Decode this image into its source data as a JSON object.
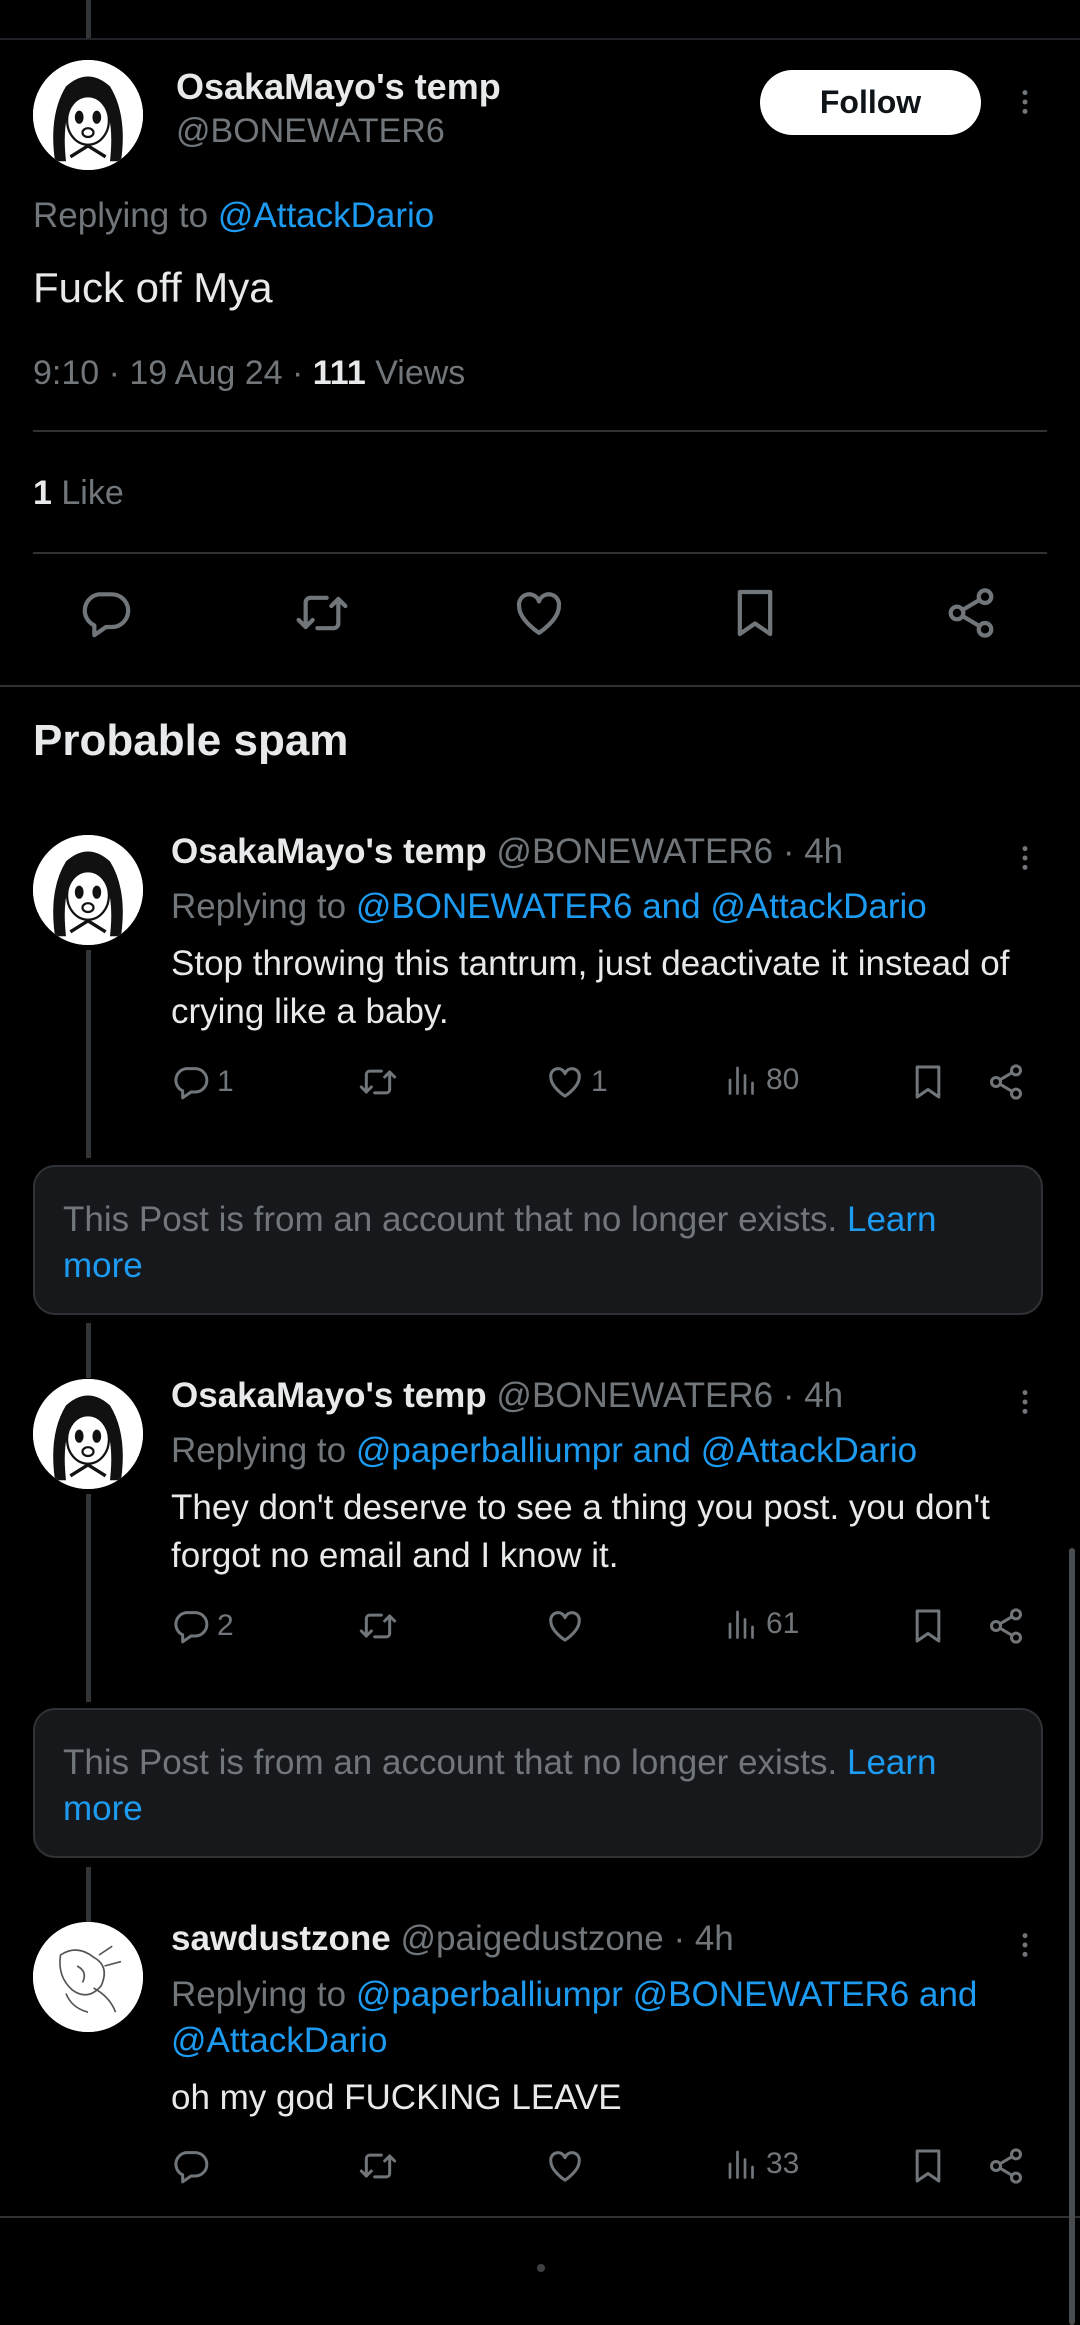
{
  "main_post": {
    "display_name": "OsakaMayo's temp",
    "handle": "@BONEWATER6",
    "follow_label": "Follow",
    "replying_prefix": "Replying to",
    "replying_to": "@AttackDario",
    "text": "Fuck off Mya",
    "time": "9:10 · 19 Aug 24 · ",
    "views_count": "111",
    "views_label": " Views",
    "likes_count": "1",
    "likes_label": " Like"
  },
  "section_title": "Probable spam",
  "replies": [
    {
      "display_name": "OsakaMayo's temp",
      "handle": "@BONEWATER6 · 4h",
      "replying_prefix": "Replying to ",
      "replying_to": "@BONEWATER6 and @AttackDario",
      "text": "Stop throwing this tantrum, just deactivate it instead of crying like a baby.",
      "comments": "1",
      "likes": "1",
      "views": "80"
    },
    {
      "display_name": "OsakaMayo's temp",
      "handle": "@BONEWATER6 · 4h",
      "replying_prefix": "Replying to ",
      "replying_to": "@paperballiumpr and @AttackDario",
      "text": "They don't deserve to see a thing you post. you don't forgot no email and I know it.",
      "comments": "2",
      "likes": "",
      "views": "61"
    },
    {
      "display_name": "sawdustzone",
      "handle": "@paigedustzone · 4h",
      "replying_prefix": "Replying to ",
      "replying_to": "@paperballiumpr @BONEWATER6 and @AttackDario",
      "text": "oh my god FUCKING LEAVE",
      "comments": "",
      "likes": "",
      "views": "33"
    }
  ],
  "notice": {
    "text": "This Post is from an account that no longer exists. ",
    "link": "Learn more"
  },
  "colors": {
    "background": "#000000",
    "accent": "#1d9bf0",
    "secondary_text": "#71767b",
    "notice_bg": "#16181c"
  }
}
